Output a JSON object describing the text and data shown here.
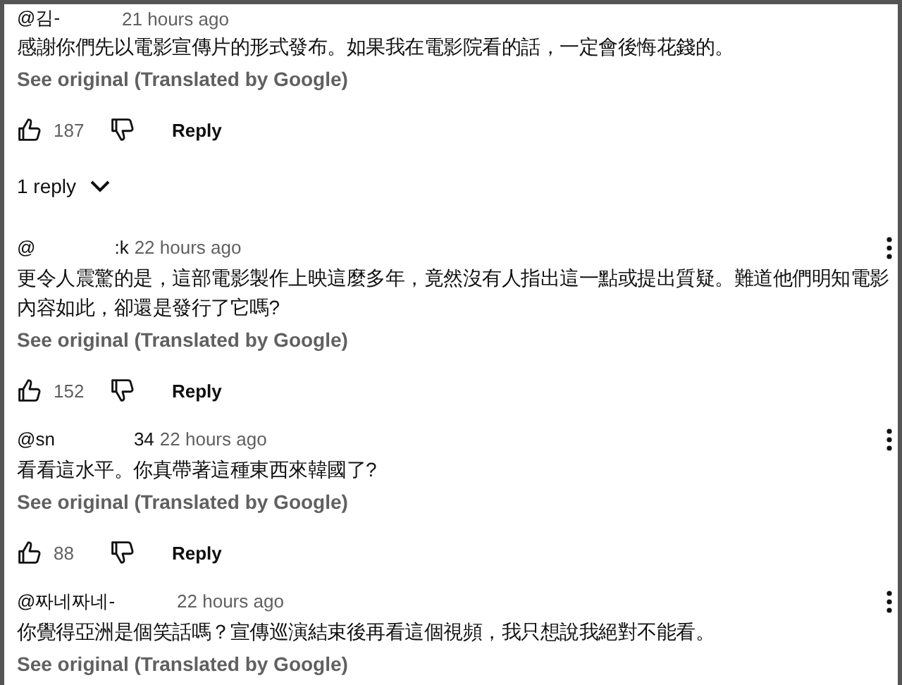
{
  "comments": [
    {
      "author": [
        "@김-"
      ],
      "time": "21 hours ago",
      "text": "感謝你們先以電影宣傳片的形式發布。如果我在電影院看的話，一定會後悔花錢的。",
      "translation": "See original (Translated by Google)",
      "likes": "187",
      "reply": "Reply",
      "replies": "1 reply",
      "menu": false
    },
    {
      "author": [
        "@",
        ":k"
      ],
      "time": "22 hours ago",
      "text": "更令人震驚的是，這部電影製作上映這麼多年，竟然沒有人指出這一點或提出質疑。難道他們明知電影內容如此，卻還是發行了它嗎?",
      "translation": "See original (Translated by Google)",
      "likes": "152",
      "reply": "Reply",
      "menu": true
    },
    {
      "author": [
        "@sn",
        "34"
      ],
      "time": "22 hours ago",
      "text": "看看這水平。你真帶著這種東西來韓國了?",
      "translation": "See original (Translated by Google)",
      "likes": "88",
      "reply": "Reply",
      "menu": true
    },
    {
      "author": [
        "@짜네짜네-"
      ],
      "time": "22 hours ago",
      "text": "你覺得亞洲是個笑話嗎？宣傳巡演結束後再看這個視頻，我只想說我絕對不能看。",
      "translation": "See original (Translated by Google)",
      "menu": true
    }
  ]
}
